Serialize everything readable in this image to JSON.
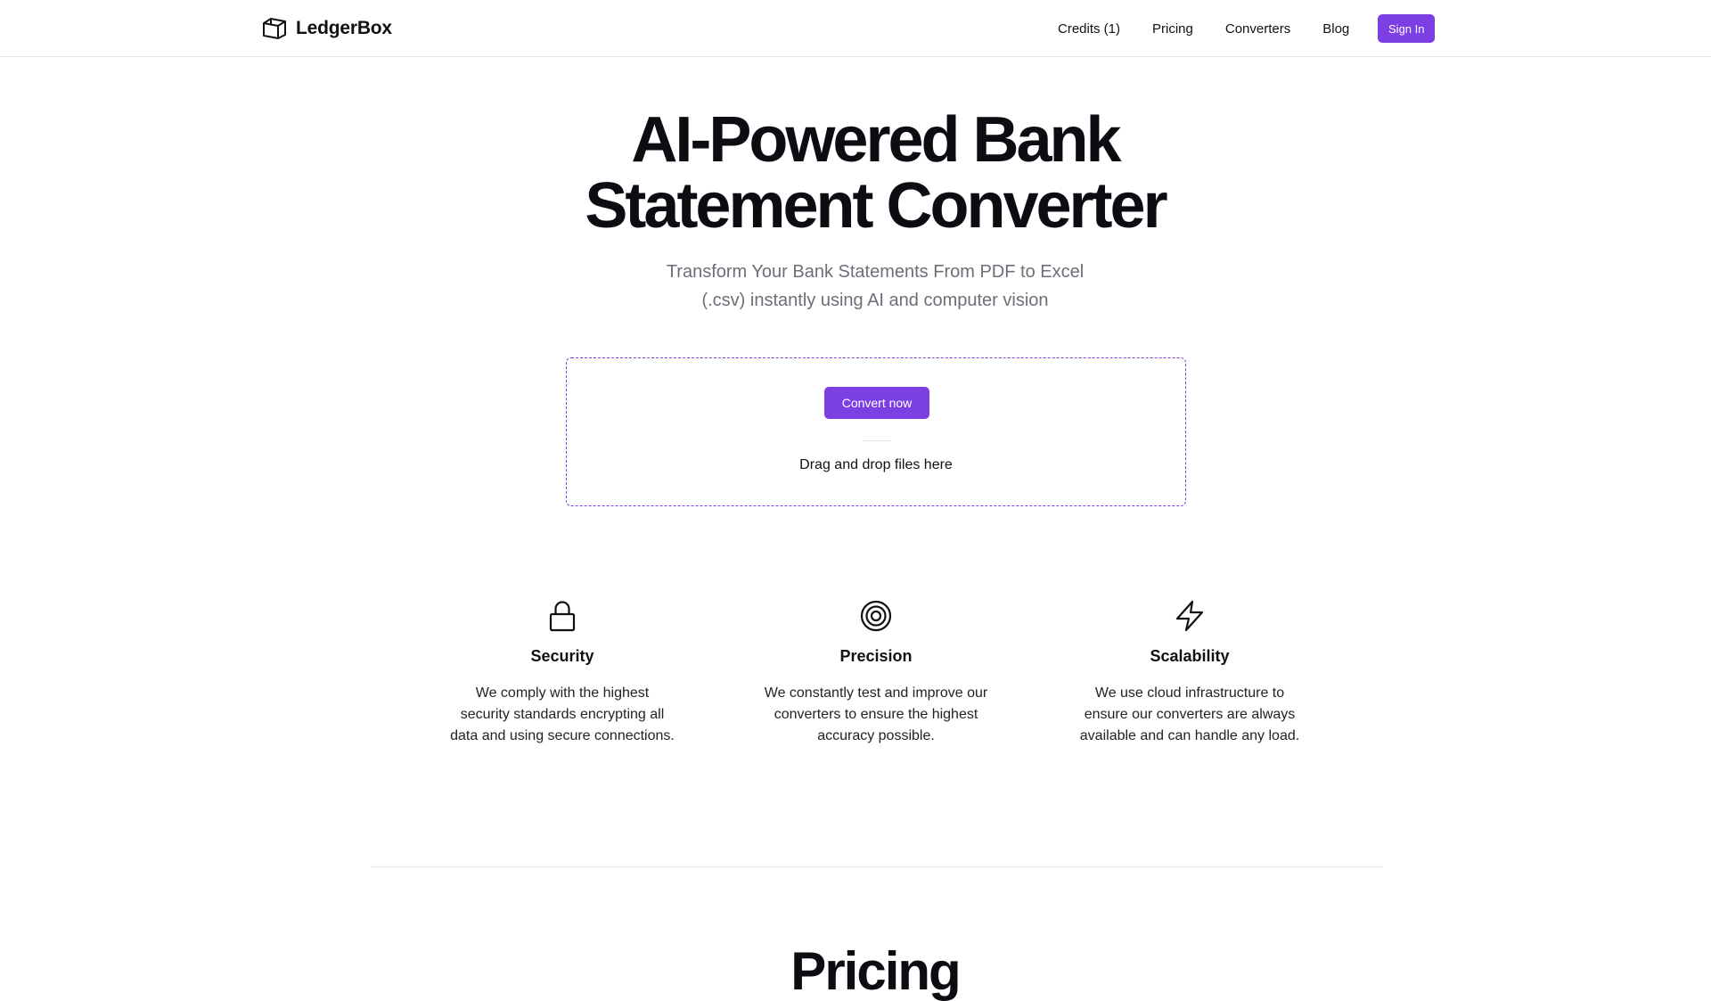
{
  "header": {
    "brand": "LedgerBox",
    "nav": [
      "Credits (1)",
      "Pricing",
      "Converters",
      "Blog"
    ],
    "sign_in": "Sign In"
  },
  "hero": {
    "title_line1": "AI-Powered Bank",
    "title_line2": "Statement Converter",
    "subtitle_line1": "Transform Your Bank Statements From PDF to Excel",
    "subtitle_line2": "(.csv) instantly using AI and computer vision"
  },
  "dropzone": {
    "button": "Convert now",
    "text": "Drag and drop files here"
  },
  "features": [
    {
      "icon": "lock-icon",
      "title": "Security",
      "desc": [
        "We comply with the highest",
        "security standards encrypting all",
        "data and using secure connections."
      ]
    },
    {
      "icon": "target-icon",
      "title": "Precision",
      "desc": [
        "We constantly test and improve our",
        "converters to ensure the highest",
        "accuracy possible."
      ]
    },
    {
      "icon": "lightning-icon",
      "title": "Scalability",
      "desc": [
        "We use cloud infrastructure to",
        "ensure our converters are always",
        "available and can handle any load."
      ]
    }
  ],
  "next_section": {
    "heading": "Pricing"
  },
  "colors": {
    "accent": "#7b3fe4",
    "divider": "#e6e6ea",
    "muted_text": "#6e6e78"
  }
}
